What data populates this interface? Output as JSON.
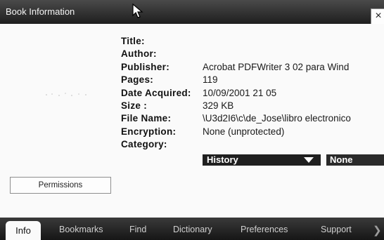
{
  "window": {
    "title": "Book Information",
    "close_glyph": "×"
  },
  "info": {
    "rows": [
      {
        "label": "Title:",
        "value": ""
      },
      {
        "label": "Author:",
        "value": ""
      },
      {
        "label": "Publisher:",
        "value": "Acrobat PDFWriter 3 02 para Wind"
      },
      {
        "label": "Pages:",
        "value": "119"
      },
      {
        "label": "Date Acquired:",
        "value": "10/09/2001 21 05"
      },
      {
        "label": "Size :",
        "value": "329 KB"
      },
      {
        "label": "File Name:",
        "value": "\\U3d2I6\\c\\de_Jose\\libro electronico"
      },
      {
        "label": "Encryption:",
        "value": "None (unprotected)"
      },
      {
        "label": "Category:",
        "value": ""
      }
    ]
  },
  "category": {
    "selected": "History",
    "secondary": "None"
  },
  "permissions_label": "Permissions",
  "tabs": [
    {
      "label": "Info",
      "active": true
    },
    {
      "label": "Bookmarks",
      "active": false
    },
    {
      "label": "Find",
      "active": false
    },
    {
      "label": "Dictionary",
      "active": false
    },
    {
      "label": "Preferences",
      "active": false
    },
    {
      "label": "Support",
      "active": false
    }
  ],
  "icons": {
    "cursor": "mouse-pointer-icon",
    "close": "close-icon",
    "dropdown": "chevron-down-icon",
    "next": "chevron-right-icon"
  },
  "colors": {
    "titlebar": "#2a2a2a",
    "tabbar": "#262626",
    "dropdown_bg": "#1f1f1f"
  }
}
